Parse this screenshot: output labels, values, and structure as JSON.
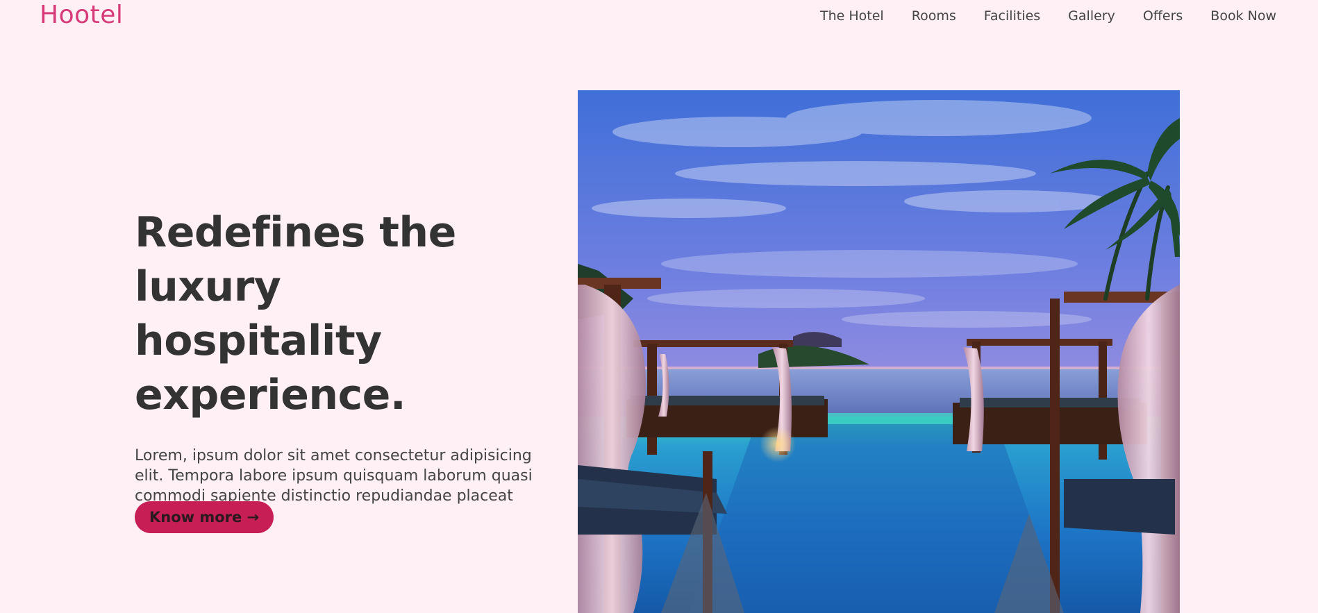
{
  "brand": {
    "logo": "Hootel"
  },
  "nav": {
    "items": [
      {
        "label": "The Hotel"
      },
      {
        "label": "Rooms"
      },
      {
        "label": "Facilities"
      },
      {
        "label": "Gallery"
      },
      {
        "label": "Offers"
      },
      {
        "label": "Book Now"
      }
    ]
  },
  "hero": {
    "title": "Redefines the luxury hospitality experience.",
    "description": "Lorem, ipsum dolor sit amet consectetur adipisicing elit. Tempora labore ipsum quisquam laborum quasi commodi sapiente distinctio repudiandae placeat architecto?",
    "cta_label": "Know more →"
  },
  "colors": {
    "background": "#fff0f5",
    "brand": "#d63a78",
    "cta_background": "#c71f55",
    "heading": "#333333"
  }
}
